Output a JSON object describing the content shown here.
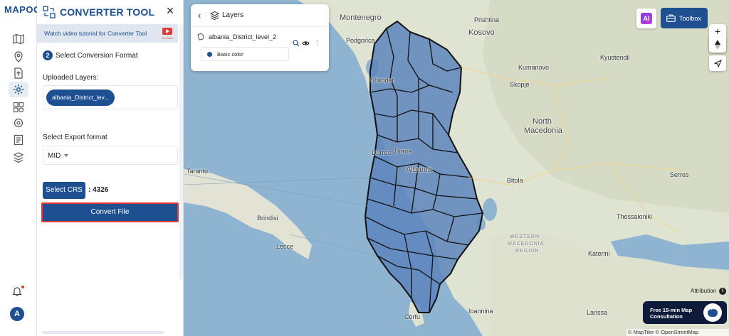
{
  "app": {
    "logo": "MAPOG"
  },
  "rail": {
    "icons": [
      "map-icon",
      "location-pin-icon",
      "upload-file-icon",
      "gear-icon",
      "layers-grid-icon",
      "settings-cog-icon",
      "report-icon",
      "shared-map-icon"
    ],
    "active_index": 3,
    "avatar_initial": "A"
  },
  "panel": {
    "title": "CONVERTER TOOL",
    "tutorial": "Watch video tutorial for Converter Tool",
    "youtube_label": "YouTube",
    "step_number": "2",
    "step_label": "Select Conversion Format",
    "uploaded_label": "Uploaded Layers:",
    "uploaded_layer": "albania_District_lev...",
    "export_label": "Select Export format",
    "export_value": "MID",
    "crs_button": "Select CRS",
    "crs_value": ": 4326",
    "convert_button": "Convert File"
  },
  "layers_panel": {
    "title": "Layers",
    "layer_name": "albania_District_level_2",
    "style_label": "Basic color",
    "style_color": "#1d4f91"
  },
  "toolbar": {
    "ai_label": "AI",
    "toolbox_label": "Toolbox",
    "zoom_in": "+",
    "zoom_out": "−"
  },
  "map": {
    "places": [
      {
        "name": "Montenegro",
        "kind": "big"
      },
      {
        "name": "Podgorica",
        "kind": "city"
      },
      {
        "name": "Prishtina",
        "kind": "city"
      },
      {
        "name": "Kosovo",
        "kind": "big"
      },
      {
        "name": "Shkoder",
        "kind": "city"
      },
      {
        "name": "Skopje",
        "kind": "city"
      },
      {
        "name": "Kyustendil",
        "kind": "city"
      },
      {
        "name": "Kumanovo",
        "kind": "city"
      },
      {
        "name": "North",
        "kind": "big"
      },
      {
        "name": "Macedonia",
        "kind": "big"
      },
      {
        "name": "Durrës",
        "kind": "city"
      },
      {
        "name": "Tirana",
        "kind": "city"
      },
      {
        "name": "Albania",
        "kind": "big"
      },
      {
        "name": "Bitola",
        "kind": "city"
      },
      {
        "name": "Serres",
        "kind": "city"
      },
      {
        "name": "Brindisi",
        "kind": "city"
      },
      {
        "name": "Lecce",
        "kind": "city"
      },
      {
        "name": "Thessaloniki",
        "kind": "city"
      },
      {
        "name": "WESTERN",
        "kind": "region"
      },
      {
        "name": "MACEDONIA",
        "kind": "region"
      },
      {
        "name": "REGION",
        "kind": "region"
      },
      {
        "name": "Katerini",
        "kind": "city"
      },
      {
        "name": "Larissa",
        "kind": "city"
      },
      {
        "name": "Corfu",
        "kind": "city"
      },
      {
        "name": "Ioannina",
        "kind": "city"
      },
      {
        "name": "Taranto",
        "kind": "city"
      }
    ]
  },
  "attribution": {
    "label": "Attribution",
    "copyright": "© MapTiler © OpenStreetMap contributors"
  },
  "consult": {
    "text": "Free 15-min Map Consultation"
  }
}
